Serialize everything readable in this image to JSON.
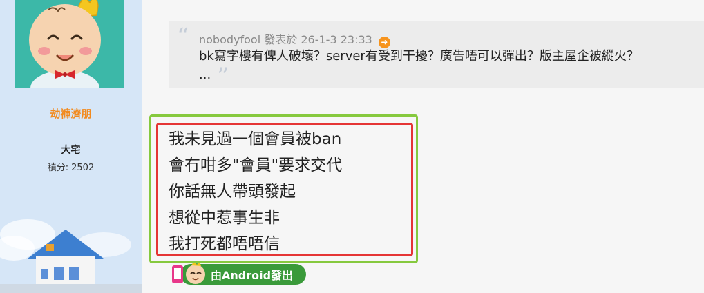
{
  "user": {
    "name": "劫褲濟朋",
    "rank": "大宅",
    "points_label": "積分:",
    "points_value": "2502"
  },
  "quote": {
    "author": "nobodyfool",
    "posted_label": "發表於",
    "datetime": "26-1-3 23:33",
    "text": "bk寫字樓有俾人破壞？server有受到干擾？廣告唔可以彈出？版主屋企被縱火？",
    "ellipsis": "..."
  },
  "message": {
    "lines": [
      "我未見過一個會員被ban",
      "會冇咁多\"會員\"要求交代",
      "你話無人帶頭發起",
      "想從中惹事生非",
      "我打死都唔唔信"
    ]
  },
  "badge": {
    "label": "由Android發出"
  },
  "colors": {
    "username": "#f28a1e",
    "green_frame": "#86c93e",
    "red_frame": "#e53535",
    "badge": "#3a9a3a"
  }
}
